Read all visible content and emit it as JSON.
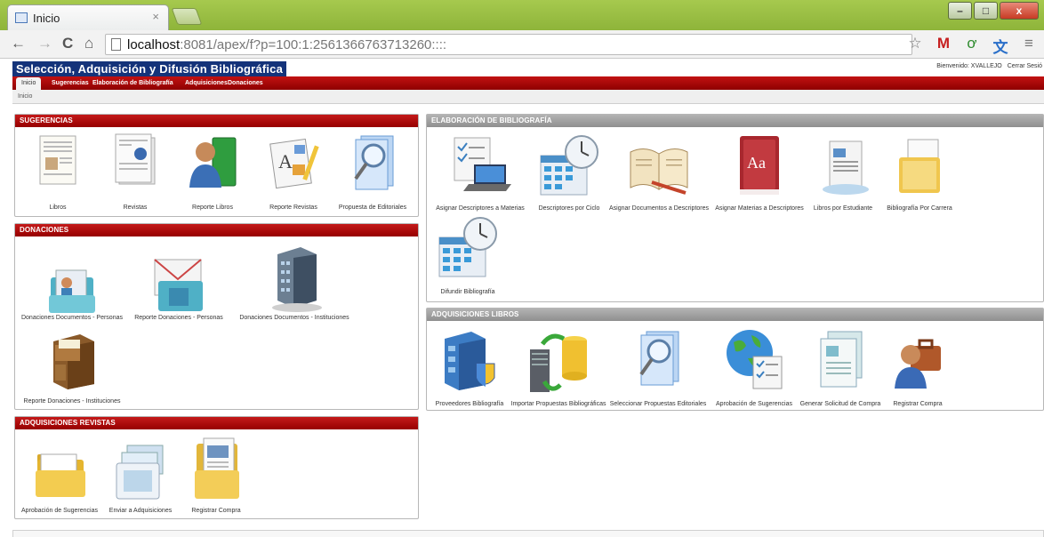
{
  "browser": {
    "tab_title": "Inicio",
    "tab_close": "×",
    "url_host": "localhost",
    "url_path": ":8081/apex/f?p=100:1:2561366763713260::::",
    "buttons": {
      "back": "←",
      "forward": "→",
      "reload": "C",
      "home": "⌂",
      "star": "☆",
      "menu": "≡"
    },
    "window": {
      "minimize": "–",
      "maximize": "□",
      "close": "x"
    }
  },
  "app": {
    "title": "Selección, Adquisición y Difusión Bibliográfica",
    "welcome": "Bienvenido: XVALLEJO",
    "logout": "Cerrar Sesió",
    "breadcrumb": "Inicio",
    "accent": "#b40000",
    "nav_tabs": [
      {
        "label": "Inicio"
      },
      {
        "label": "Sugerencias"
      },
      {
        "label": "Elaboración de Bibliografía"
      },
      {
        "label": "Adquisiciones"
      },
      {
        "label": "Donaciones"
      }
    ]
  },
  "regions": {
    "sugerencias": {
      "title": "SUGERENCIAS",
      "items": [
        {
          "label": "Libros",
          "icon": "document-page-icon"
        },
        {
          "label": "Revistas",
          "icon": "magazine-page-icon"
        },
        {
          "label": "Reporte Libros",
          "icon": "user-book-icon"
        },
        {
          "label": "Reporte Revistas",
          "icon": "report-pencil-icon"
        },
        {
          "label": "Propuesta de Editoriales",
          "icon": "search-documents-icon"
        }
      ]
    },
    "donaciones": {
      "title": "DONACIONES",
      "items": [
        {
          "label": "Donaciones Documentos - Personas",
          "icon": "contact-folder-icon"
        },
        {
          "label": "Reporte Donaciones - Personas",
          "icon": "mail-folder-icon"
        },
        {
          "label": "Donaciones Documentos - Instituciones",
          "icon": "building-icon"
        },
        {
          "label": "Reporte Donaciones - Instituciones",
          "icon": "file-cabinet-icon"
        }
      ]
    },
    "adquisiciones_revistas": {
      "title": "ADQUISICIONES REVISTAS",
      "items": [
        {
          "label": "Aprobación de Sugerencias",
          "icon": "folder-icon"
        },
        {
          "label": "Enviar a Adquisiciones",
          "icon": "send-pictures-icon"
        },
        {
          "label": "Registrar Compra",
          "icon": "folder-document-icon"
        }
      ]
    },
    "elaboracion": {
      "title": "ELABORACIÓN DE BIBLIOGRAFÍA",
      "items": [
        {
          "label": "Asignar Descriptores a Materias",
          "icon": "checklist-laptop-icon"
        },
        {
          "label": "Descriptores por Ciclo",
          "icon": "calendar-clock-icon"
        },
        {
          "label": "Asignar Documentos a Descriptores",
          "icon": "open-book-icon"
        },
        {
          "label": "Asignar Materias a Descriptores",
          "icon": "dictionary-icon"
        },
        {
          "label": "Libros por Estudiante",
          "icon": "document-stack-icon"
        },
        {
          "label": "Bibliografía Por Carrera",
          "icon": "folder-page-icon"
        },
        {
          "label": "Difundir Bibliografía",
          "icon": "calendar-clock-icon"
        }
      ]
    },
    "adquisiciones_libros": {
      "title": "ADQUISICIONES LIBROS",
      "items": [
        {
          "label": "Proveedores Bibliografía",
          "icon": "shield-building-icon"
        },
        {
          "label": "Importar Propuestas Bibliográficas",
          "icon": "server-sync-icon"
        },
        {
          "label": "Seleccionar Propuestas Editoriales",
          "icon": "search-documents-icon"
        },
        {
          "label": "Aprobación de Sugerencias",
          "icon": "globe-checklist-icon"
        },
        {
          "label": "Generar Solicitud de Compra",
          "icon": "form-icon"
        },
        {
          "label": "Registrar Compra",
          "icon": "user-briefcase-icon"
        }
      ]
    }
  }
}
